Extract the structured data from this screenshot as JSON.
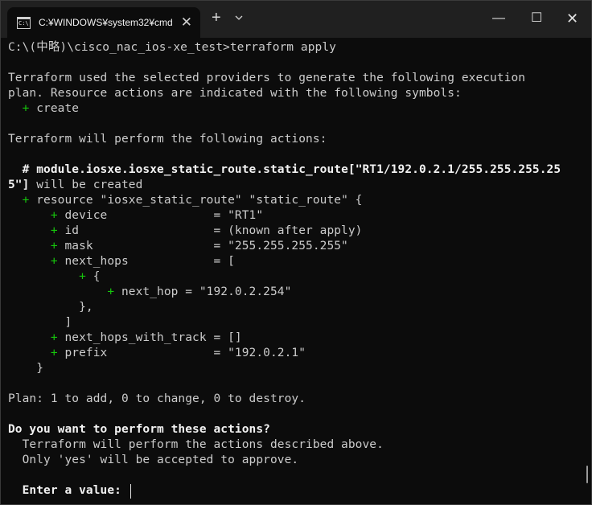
{
  "window": {
    "tab_title": "C:¥WINDOWS¥system32¥cmd",
    "tab_close": "✕",
    "new_tab": "+",
    "minimize": "—",
    "maximize": "☐",
    "close": "✕",
    "icon_text": "C:\\"
  },
  "terminal": {
    "prompt": "C:\\(中略)\\cisco_nac_ios-xe_test>terraform apply",
    "intro_1": "Terraform used the selected providers to generate the following execution",
    "intro_2": "plan. Resource actions are indicated with the following symbols:",
    "sym_plus": "+",
    "sym_create": " create",
    "perform": "Terraform will perform the following actions:",
    "hash_mark": "  # ",
    "module_path": "module.iosxe.iosxe_static_route.static_route[\"RT1/192.0.2.1/255.255.255.25",
    "module_path_cont": "5\"]",
    "will_be_created": " will be created",
    "resource": " resource \"iosxe_static_route\" \"static_route\" {",
    "device": " device               = \"RT1\"",
    "id": " id                   = (known after apply)",
    "mask": " mask                 = \"255.255.255.255\"",
    "next_hops": " next_hops            = [",
    "brace_open": " {",
    "next_hop": " next_hop = \"192.0.2.254\"",
    "brace_close_comma": "          },",
    "bracket_close": "        ]",
    "next_hops_with_track": " next_hops_with_track = []",
    "prefix": " prefix               = \"192.0.2.1\"",
    "resource_close": "    }",
    "plan": "Plan: 1 to add, 0 to change, 0 to destroy.",
    "question": "Do you want to perform these actions?",
    "desc_1": "  Terraform will perform the actions described above.",
    "desc_2": "  Only 'yes' will be accepted to approve.",
    "enter_label": "  Enter a value: "
  }
}
